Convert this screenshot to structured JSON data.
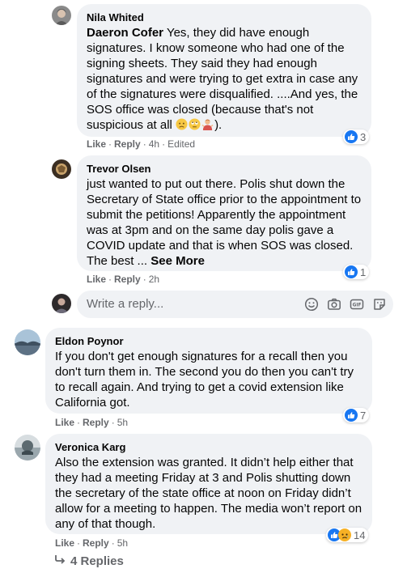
{
  "comments": [
    {
      "author": "Nila Whited",
      "mention": "Daeron Cofer",
      "text": "Yes, they did have enough signatures. I know someone who had one of the signing sheets. They said they had enough signatures and were trying to get extra in case any of the signatures were disqualified. ....And yes, the SOS office was closed (because that's not suspicious at all",
      "text_end": ").",
      "like": "Like",
      "reply": "Reply",
      "time": "4h",
      "edited": "Edited",
      "reaction_count": "3",
      "reaction_icons": [
        "like-icon"
      ]
    },
    {
      "author": "Trevor Olsen",
      "text": "just wanted to put out there. Polis shut down the Secretary of State office prior to the appointment to submit the petitions! Apparently the appointment was at 3pm and on the same day polis gave a COVID update and that is when SOS was closed. The best ...",
      "see_more": "See More",
      "like": "Like",
      "reply": "Reply",
      "time": "2h",
      "reaction_count": "1",
      "reaction_icons": [
        "like-icon"
      ]
    },
    {
      "author": "Eldon Poynor",
      "text": "If you don't get enough signatures for a recall then you don't turn them in. The second you do then you can't try to recall again. And trying to get a covid extension like California got.",
      "like": "Like",
      "reply": "Reply",
      "time": "5h",
      "reaction_count": "7",
      "reaction_icons": [
        "like-icon"
      ]
    },
    {
      "author": "Veronica Karg",
      "text": "Also the extension was granted. It didn’t help either that they had a meeting Friday at 3 and Polis shutting down the secretary of the state office at noon on Friday didn’t allow for a meeting to happen. The media won’t report on any of that though.",
      "like": "Like",
      "reply": "Reply",
      "time": "5h",
      "reaction_count": "14",
      "reaction_icons": [
        "like-icon",
        "sad-icon"
      ]
    }
  ],
  "reply_box": {
    "placeholder": "Write a reply...",
    "icons": [
      "emoji-icon",
      "camera-icon",
      "gif-icon",
      "sticker-icon"
    ]
  },
  "view_replies": {
    "label": "4 Replies",
    "icon": "reply-arrow-icon"
  },
  "colors": {
    "bubble": "#f0f2f5",
    "meta_text": "#65676b",
    "like_blue": "#1877f2",
    "sad_yellow": "#f7b125"
  }
}
